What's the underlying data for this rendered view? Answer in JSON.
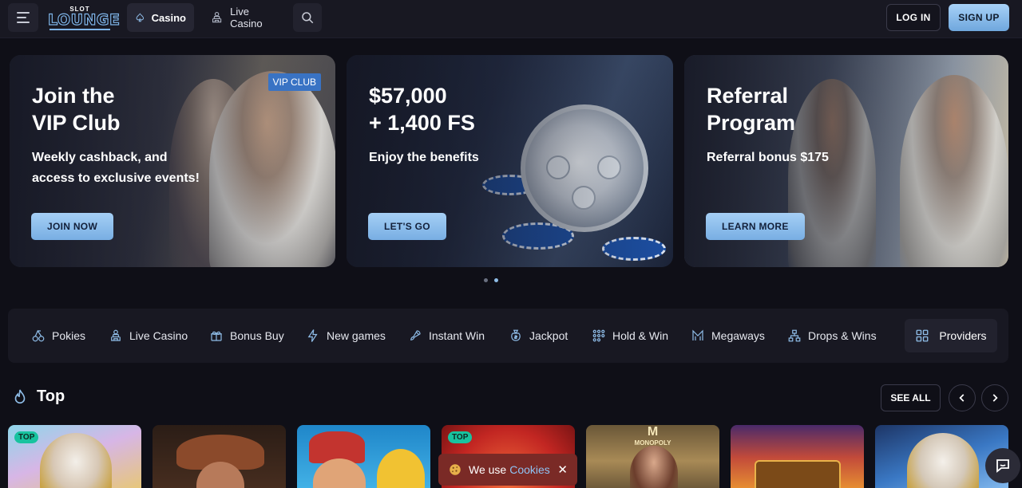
{
  "header": {
    "logo_top": "SLOT",
    "logo_main": "LOUNGE",
    "tabs": [
      {
        "label": "Casino",
        "icon": "spade-icon",
        "active": true
      },
      {
        "label": "Live Casino",
        "icon": "dealer-icon",
        "active": false
      }
    ],
    "login_label": "LOG IN",
    "signup_label": "SIGN UP"
  },
  "banners": [
    {
      "title_l1": "Join the",
      "title_l2": "VIP Club",
      "text_l1": "Weekly cashback, and",
      "text_l2": "access to exclusive events!",
      "cta": "JOIN NOW",
      "badge": "VIP CLUB"
    },
    {
      "title_l1": "$57,000",
      "title_l2": "+ 1,400 FS",
      "text_l1": "Enjoy the benefits",
      "cta": "LET'S GO"
    },
    {
      "title_l1": "Referral",
      "title_l2": "Program",
      "text_l1": "Referral bonus $175",
      "cta": "LEARN MORE"
    }
  ],
  "categories": [
    {
      "label": "Pokies",
      "icon": "cherries-icon"
    },
    {
      "label": "Live Casino",
      "icon": "dealer-icon"
    },
    {
      "label": "Bonus Buy",
      "icon": "gift-icon"
    },
    {
      "label": "New games",
      "icon": "lightning-icon"
    },
    {
      "label": "Instant Win",
      "icon": "rocket-icon"
    },
    {
      "label": "Jackpot",
      "icon": "money-bag-icon"
    },
    {
      "label": "Hold & Win",
      "icon": "dots-grid-icon"
    },
    {
      "label": "Megaways",
      "icon": "megaways-icon"
    },
    {
      "label": "Drops & Wins",
      "icon": "network-icon"
    }
  ],
  "providers_label": "Providers",
  "top_section": {
    "title": "Top",
    "see_all": "SEE ALL",
    "tag": "TOP",
    "tile_label_m": "M",
    "tile_label_monopoly": "MONOPOLY"
  },
  "cookie": {
    "text": "We use",
    "link": "Cookies",
    "close": "✕"
  },
  "colors": {
    "accent": "#8fbde8",
    "bg": "#0f0f17",
    "panel": "#181822",
    "top_tag": "#18c39f",
    "cookie_bg": "#7a2a26"
  }
}
